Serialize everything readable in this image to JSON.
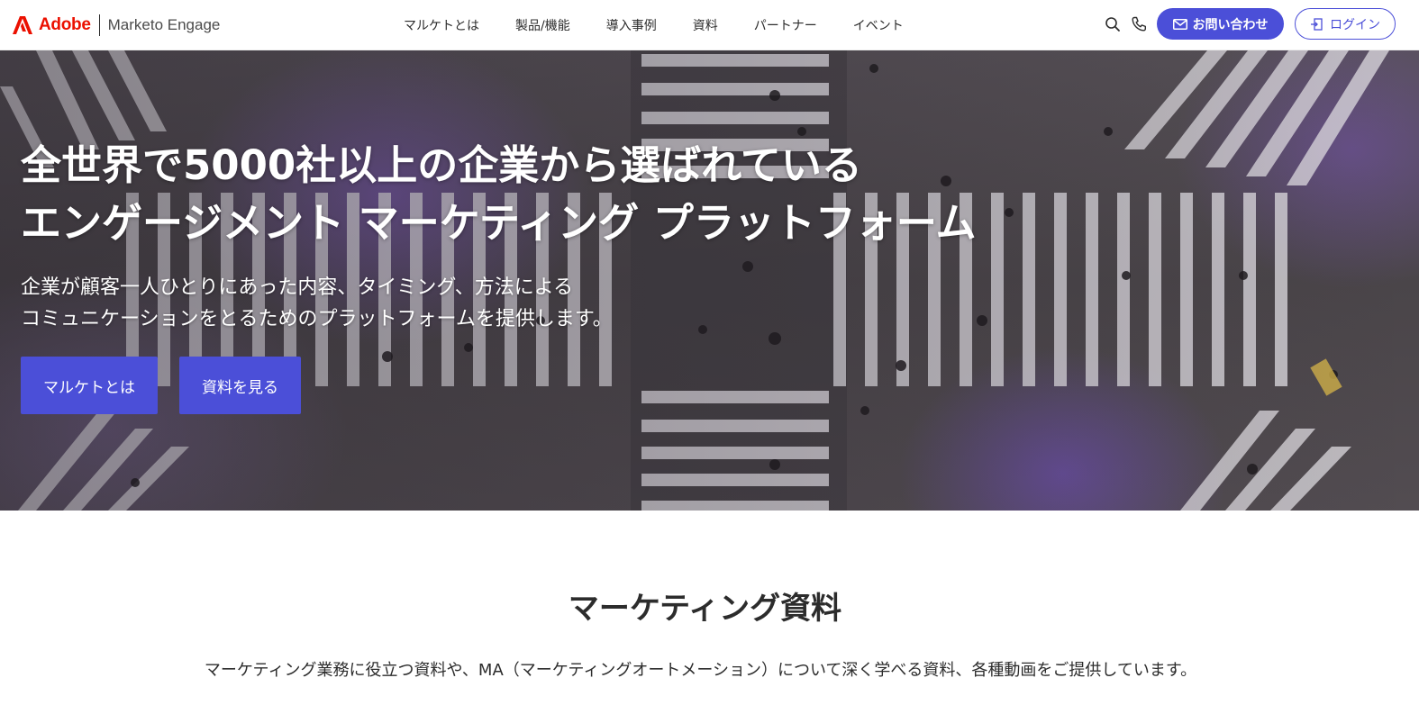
{
  "header": {
    "brand": {
      "company": "Adobe",
      "product": "Marketo Engage"
    },
    "nav": [
      {
        "label": "マルケトとは"
      },
      {
        "label": "製品/機能"
      },
      {
        "label": "導入事例"
      },
      {
        "label": "資料"
      },
      {
        "label": "パートナー"
      },
      {
        "label": "イベント"
      }
    ],
    "icons": [
      "search-icon",
      "phone-icon",
      "mail-icon",
      "login-icon"
    ],
    "contact_label": "お問い合わせ",
    "login_label": "ログイン"
  },
  "hero": {
    "title_line1": "全世界で5000社以上の企業から選ばれている",
    "title_line2": "エンゲージメント マーケティング プラットフォーム",
    "sub_line1": "企業が顧客一人ひとりにあった内容、タイミング、方法による",
    "sub_line2": "コミュニケーションをとるためのプラットフォームを提供します。",
    "buttons": [
      {
        "label": "マルケトとは"
      },
      {
        "label": "資料を見る"
      }
    ]
  },
  "section": {
    "title": "マーケティング資料",
    "description": "マーケティング業務に役立つ資料や、MA（マーケティングオートメーション）について深く学べる資料、各種動画をご提供しています。"
  },
  "colors": {
    "accent": "#4b4fd8",
    "adobe_red": "#eb1000",
    "text": "#2c2c2c"
  }
}
